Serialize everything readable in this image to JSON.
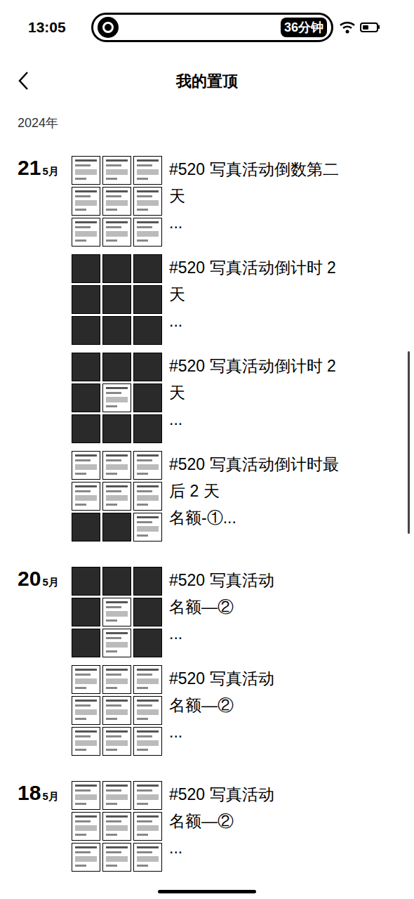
{
  "status_bar": {
    "time": "13:05",
    "island_badge": "36分钟"
  },
  "nav": {
    "title": "我的置顶"
  },
  "year": "2024年",
  "groups": [
    {
      "day": "21",
      "month": "5月",
      "entries": [
        {
          "lines": [
            "#520 写真活动倒数第二",
            "天",
            "..."
          ],
          "thumbs": [
            "screen",
            "screen",
            "screen",
            "screen",
            "screen",
            "screen",
            "screen",
            "screen",
            "screen"
          ]
        },
        {
          "lines": [
            "#520 写真活动倒计时 2",
            "天",
            "..."
          ],
          "thumbs": [
            "photo",
            "photo",
            "photo",
            "photo",
            "photo",
            "photo",
            "photo",
            "photo",
            "photo"
          ]
        },
        {
          "lines": [
            "#520 写真活动倒计时 2",
            "天",
            "..."
          ],
          "thumbs": [
            "photo",
            "photo",
            "photo",
            "photo",
            "screen",
            "photo",
            "photo",
            "photo",
            "photo"
          ]
        },
        {
          "lines": [
            "#520 写真活动倒计时最",
            "后 2 天",
            "名额-①..."
          ],
          "thumbs": [
            "screen",
            "screen",
            "screen",
            "screen",
            "screen",
            "screen",
            "photo",
            "photo",
            "screen"
          ]
        }
      ]
    },
    {
      "day": "20",
      "month": "5月",
      "entries": [
        {
          "lines": [
            "#520 写真活动",
            "名额—②",
            "..."
          ],
          "thumbs": [
            "photo",
            "photo",
            "photo",
            "photo",
            "screen",
            "photo",
            "photo",
            "screen",
            "photo"
          ]
        },
        {
          "lines": [
            "#520 写真活动",
            "名额—②",
            "..."
          ],
          "thumbs": [
            "screen",
            "screen",
            "screen",
            "screen",
            "screen",
            "screen",
            "screen",
            "screen",
            "screen"
          ]
        }
      ]
    },
    {
      "day": "18",
      "month": "5月",
      "entries": [
        {
          "lines": [
            "#520 写真活动",
            "名额—②",
            "..."
          ],
          "thumbs": [
            "screen",
            "screen",
            "screen",
            "screen",
            "screen",
            "screen",
            "screen",
            "screen",
            "screen"
          ]
        }
      ]
    }
  ]
}
